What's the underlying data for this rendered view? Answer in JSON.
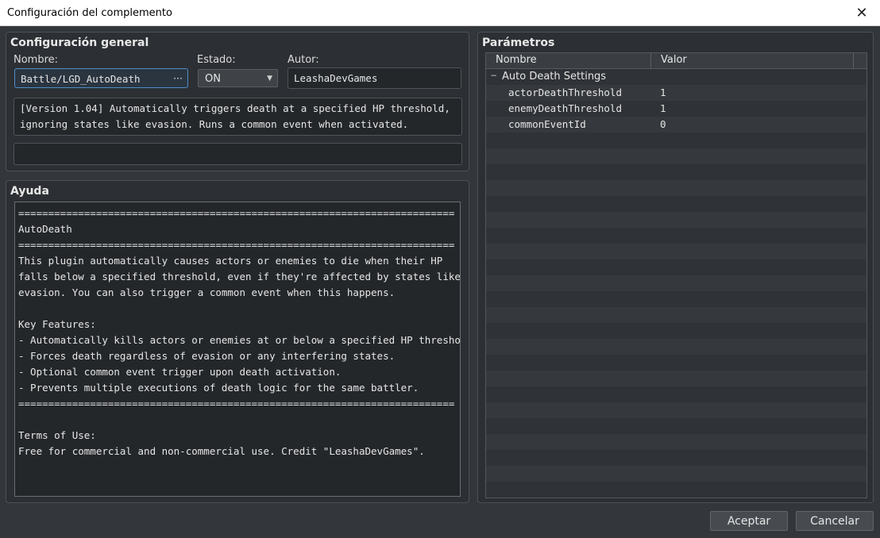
{
  "window": {
    "title": "Configuración del complemento"
  },
  "general": {
    "section_title": "Configuración general",
    "name_label": "Nombre:",
    "name_value": "Battle/LGD_AutoDeath",
    "name_dots": "···",
    "status_label": "Estado:",
    "status_value": "ON",
    "author_label": "Autor:",
    "author_value": "LeashaDevGames",
    "description": "[Version 1.04] Automatically triggers death at a specified HP threshold,\nignoring states like evasion. Runs a common event when activated.",
    "extra_field": ""
  },
  "help": {
    "section_title": "Ayuda",
    "text": "=========================================================================\nAutoDeath\n=========================================================================\nThis plugin automatically causes actors or enemies to die when their HP\nfalls below a specified threshold, even if they're affected by states like\nevasion. You can also trigger a common event when this happens.\n\nKey Features:\n- Automatically kills actors or enemies at or below a specified HP threshold.\n- Forces death regardless of evasion or any interfering states.\n- Optional common event trigger upon death activation.\n- Prevents multiple executions of death logic for the same battler.\n=========================================================================\n\nTerms of Use:\nFree for commercial and non-commercial use. Credit \"LeashaDevGames\"."
  },
  "params": {
    "section_title": "Parámetros",
    "col_name": "Nombre",
    "col_value": "Valor",
    "group_toggle": "−",
    "group": "Auto Death Settings",
    "rows": [
      {
        "name": "actorDeathThreshold",
        "value": "1"
      },
      {
        "name": "enemyDeathThreshold",
        "value": "1"
      },
      {
        "name": "commonEventId",
        "value": "0"
      }
    ]
  },
  "buttons": {
    "ok": "Aceptar",
    "cancel": "Cancelar"
  }
}
